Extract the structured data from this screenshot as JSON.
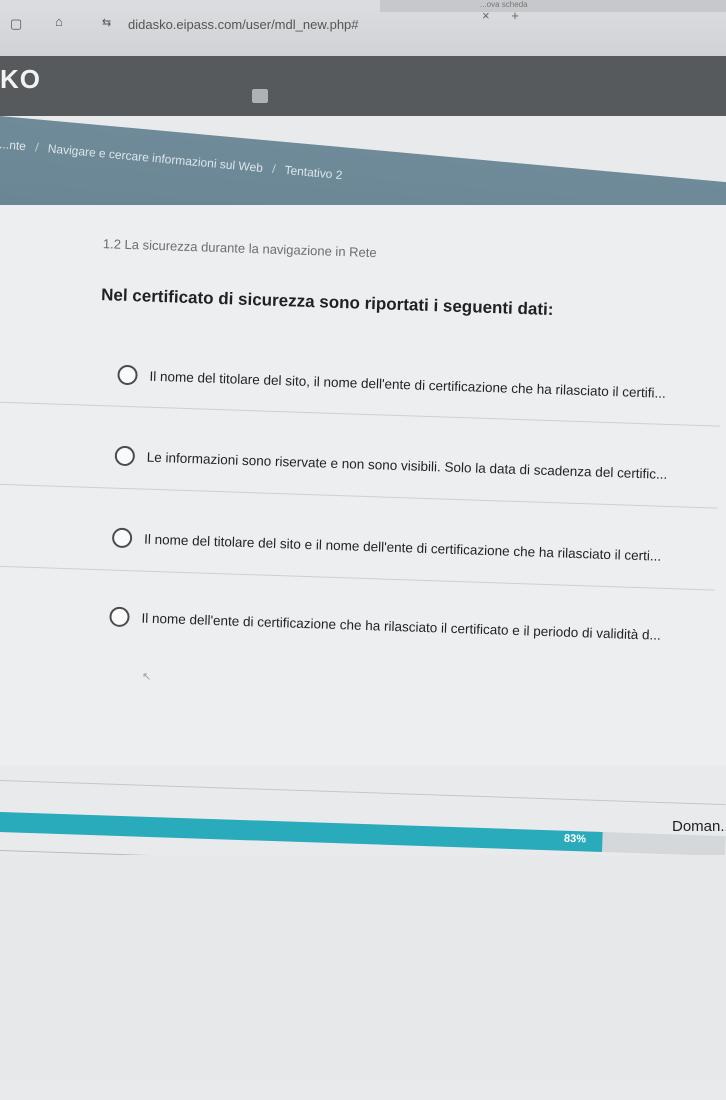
{
  "browser": {
    "tab_title": "...ova scheda",
    "url": "didasko.eipass.com/user/mdl_new.php#",
    "tab_close": "×",
    "new_tab": "+"
  },
  "app": {
    "logo": "KO",
    "breadcrumb": [
      "...nte",
      "Navigare e cercare informazioni sul Web",
      "Tentativo 2"
    ],
    "breadcrumb_sep": "/"
  },
  "quiz": {
    "section_title": "1.2 La sicurezza durante la navigazione in Rete",
    "question": "Nel certificato di sicurezza sono riportati i seguenti dati:",
    "options": [
      "Il nome del titolare del sito, il nome dell'ente di certificazione che ha rilasciato il certifi...",
      "Le informazioni sono riservate e non sono visibili. Solo la data di scadenza del certific...",
      "Il nome del titolare del sito e il nome dell'ente di certificazione che ha rilasciato il certi...",
      "Il nome dell'ente di certificazione che ha rilasciato il certificato e il periodo di validità d..."
    ]
  },
  "progress": {
    "label": "Doman...",
    "percent_text": "83%",
    "fraction": 0.83,
    "fill_color": "#29abbb"
  },
  "icons": [
    "back-icon",
    "lock-icon",
    "site-settings-icon",
    "minimize-icon",
    "new-tab-icon",
    "radio-icon"
  ]
}
